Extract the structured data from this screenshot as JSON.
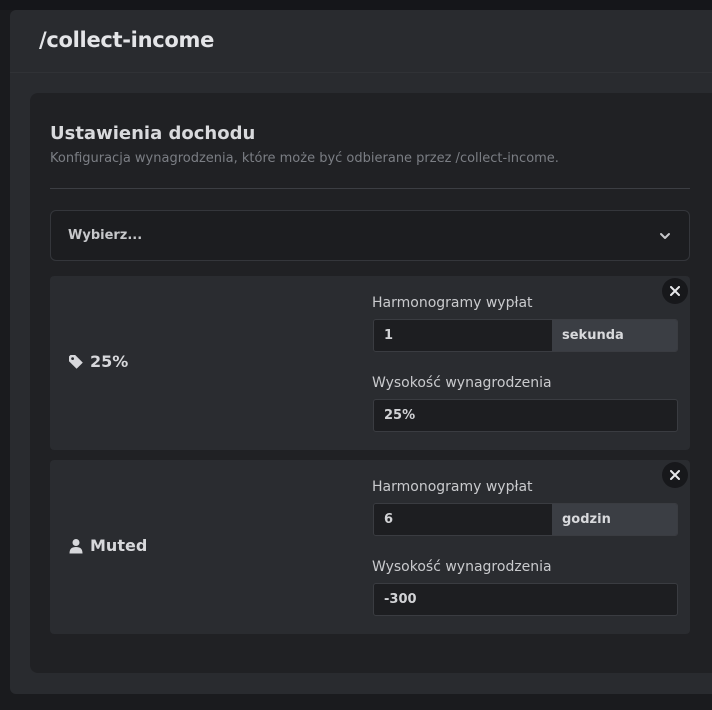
{
  "command": {
    "title": "/collect-income"
  },
  "settings": {
    "title": "Ustawienia dochodu",
    "subtitle": "Konfiguracja wynagrodzenia, które może być odbierane przez /collect-income.",
    "select_placeholder": "Wybierz..."
  },
  "items": [
    {
      "icon": "tag-icon",
      "label": "25%",
      "schedule_label": "Harmonogramy wypłat",
      "schedule_value": "1",
      "schedule_unit": "sekunda",
      "amount_label": "Wysokość wynagrodzenia",
      "amount_value": "25%"
    },
    {
      "icon": "user-icon",
      "label": "Muted",
      "schedule_label": "Harmonogramy wypłat",
      "schedule_value": "6",
      "schedule_unit": "godzin",
      "amount_label": "Wysokość wynagrodzenia",
      "amount_value": "-300"
    }
  ]
}
